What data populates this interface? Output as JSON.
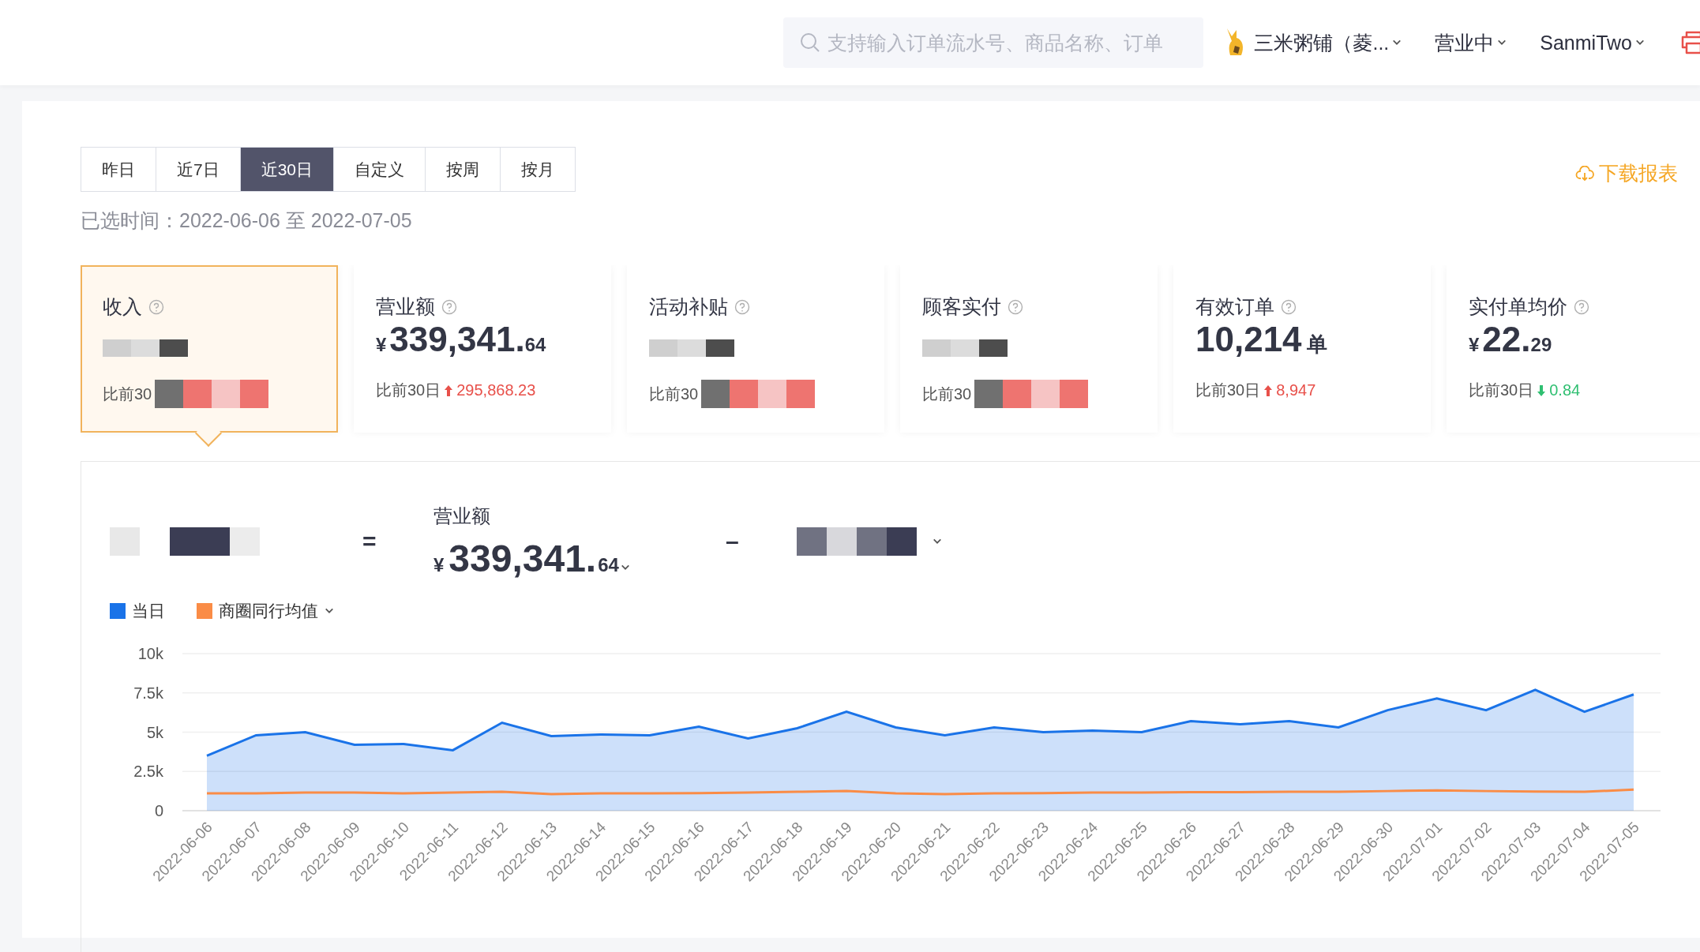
{
  "top_bar": {
    "search": {
      "placeholder": "支持输入订单流水号、商品名称、订单"
    },
    "store": "三米粥铺（菱...",
    "status": "营业中",
    "user": "SanmiTwo"
  },
  "range_tabs": [
    {
      "label": "昨日",
      "selected": false
    },
    {
      "label": "近7日",
      "selected": false
    },
    {
      "label": "近30日",
      "selected": true
    },
    {
      "label": "自定义",
      "selected": false
    },
    {
      "label": "按周",
      "selected": false
    },
    {
      "label": "按月",
      "selected": false
    }
  ],
  "download": "下载报表",
  "selected_range": "已选时间：2022-06-06 至 2022-07-05",
  "cards": [
    {
      "title": "收入",
      "selected": true,
      "redacted": true,
      "compare": "比前30"
    },
    {
      "title": "营业额",
      "selected": false,
      "redacted": false,
      "prefix": "¥",
      "main": "339,341.",
      "decimal": "64",
      "compare": "比前30日",
      "rising": true,
      "change": "295,868.23"
    },
    {
      "title": "活动补贴",
      "selected": false,
      "redacted": true,
      "compare": "比前30"
    },
    {
      "title": "顾客实付",
      "selected": false,
      "redacted": true,
      "compare": "比前30"
    },
    {
      "title": "有效订单",
      "selected": false,
      "redacted": false,
      "main": "10,214",
      "unit": "单",
      "compare": "比前30日",
      "rising": true,
      "change": "8,947"
    },
    {
      "title": "实付单均价",
      "selected": false,
      "redacted": false,
      "prefix": "¥",
      "main": "22.",
      "decimal": "29",
      "compare": "比前30日",
      "rising": false,
      "change": "0.84"
    }
  ],
  "formula": {
    "operators": [
      "=",
      "–"
    ],
    "terms": [
      {
        "redacted": true,
        "dropdown": false
      },
      {
        "redacted": false,
        "label": "营业额",
        "prefix": "¥",
        "main": "339,341.",
        "decimal": "64",
        "dropdown": true
      },
      {
        "redacted": true,
        "dropdown": true
      }
    ]
  },
  "legend": [
    {
      "dropdown": false
    },
    {
      "dropdown": true
    }
  ],
  "chart_data": {
    "type": "area",
    "grid": true,
    "yticks": [
      {
        "value": 0,
        "label": "0"
      },
      {
        "value": 2500,
        "label": "2.5k"
      },
      {
        "value": 5000,
        "label": "5k"
      },
      {
        "value": 7500,
        "label": "7.5k"
      },
      {
        "value": 10000,
        "label": "10k"
      }
    ],
    "ylim": [
      0,
      10000
    ],
    "categories": [
      "2022-06-06",
      "2022-06-07",
      "2022-06-08",
      "2022-06-09",
      "2022-06-10",
      "2022-06-11",
      "2022-06-12",
      "2022-06-13",
      "2022-06-14",
      "2022-06-15",
      "2022-06-16",
      "2022-06-17",
      "2022-06-18",
      "2022-06-19",
      "2022-06-20",
      "2022-06-21",
      "2022-06-22",
      "2022-06-23",
      "2022-06-24",
      "2022-06-25",
      "2022-06-26",
      "2022-06-27",
      "2022-06-28",
      "2022-06-29",
      "2022-06-30",
      "2022-07-01",
      "2022-07-02",
      "2022-07-03",
      "2022-07-04",
      "2022-07-05"
    ],
    "series": [
      {
        "name": "当日",
        "type": "area",
        "color": "#1a73e8",
        "values": [
          3500,
          4800,
          5000,
          4200,
          4250,
          3850,
          5600,
          4750,
          4850,
          4800,
          5350,
          4600,
          5250,
          6300,
          5300,
          4800,
          5300,
          5000,
          5100,
          5000,
          5700,
          5500,
          5700,
          5300,
          6400,
          7150,
          6400,
          7700,
          6300,
          7400
        ]
      },
      {
        "name": "商圈同行均值",
        "type": "line",
        "color": "#fa8c46",
        "values": [
          1100,
          1100,
          1150,
          1150,
          1100,
          1150,
          1200,
          1050,
          1100,
          1100,
          1120,
          1150,
          1200,
          1250,
          1100,
          1050,
          1100,
          1120,
          1150,
          1150,
          1180,
          1180,
          1200,
          1200,
          1250,
          1300,
          1250,
          1220,
          1200,
          1350
        ]
      }
    ]
  }
}
